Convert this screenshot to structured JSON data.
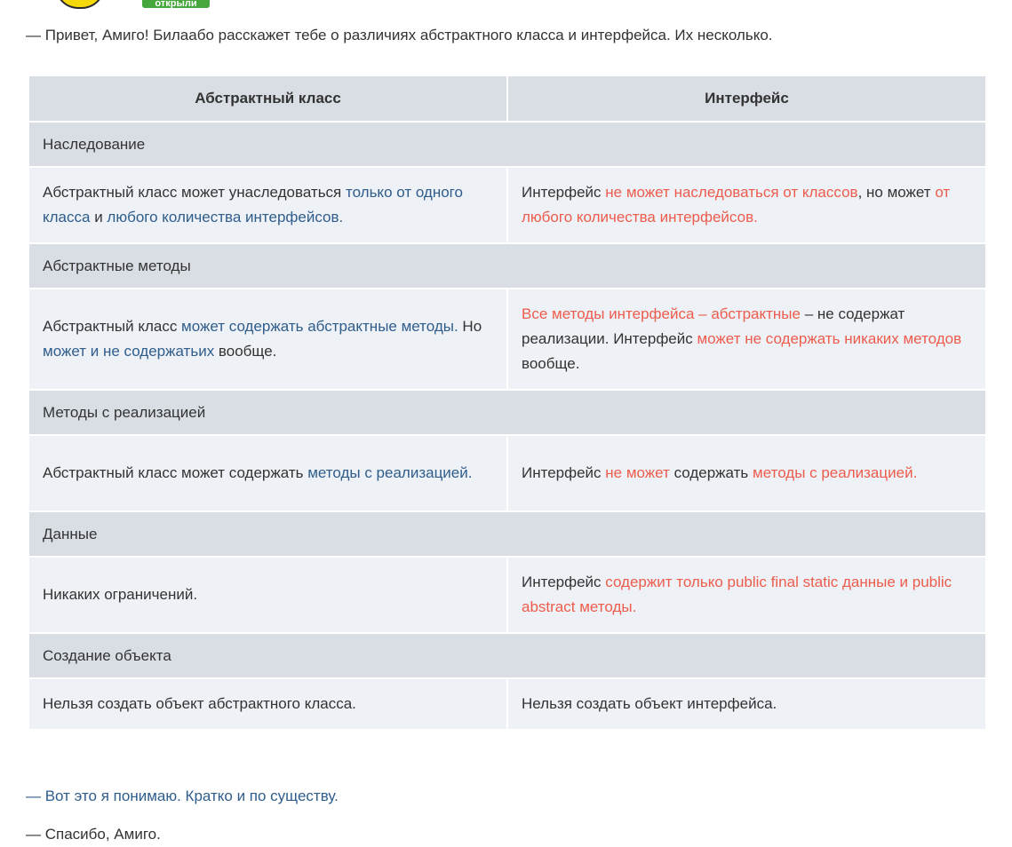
{
  "header": {
    "badge_label": "открыли"
  },
  "intro": "— Привет, Амиго! Билаабо расскажет тебе о различиях абстрактного класса и интерфейса. Их несколько.",
  "table": {
    "headers": [
      "Абстрактный класс",
      "Интерфейс"
    ],
    "sections": [
      {
        "title": "Наследование",
        "left": [
          {
            "t": "Абстрактный класс может унаследоваться ",
            "c": "plain"
          },
          {
            "t": "только от одного класса",
            "c": "blue"
          },
          {
            "t": " и ",
            "c": "plain"
          },
          {
            "t": "любого количества интерфейсов.",
            "c": "blue"
          }
        ],
        "right": [
          {
            "t": "Интерфейс ",
            "c": "plain"
          },
          {
            "t": "не может наследоваться от классов",
            "c": "red"
          },
          {
            "t": ", но может ",
            "c": "plain"
          },
          {
            "t": "от любого количества интерфейсов.",
            "c": "red"
          }
        ]
      },
      {
        "title": "Абстрактные методы",
        "left": [
          {
            "t": "Абстрактный класс ",
            "c": "plain"
          },
          {
            "t": "может содержать абстрактные методы.",
            "c": "blue"
          },
          {
            "t": " Но ",
            "c": "plain"
          },
          {
            "t": "может и не содержатьих",
            "c": "blue"
          },
          {
            "t": " вообще.",
            "c": "plain"
          }
        ],
        "right": [
          {
            "t": "Все методы интерфейса – абстрактные",
            "c": "red"
          },
          {
            "t": " – не содержат реализации. Интерфейс ",
            "c": "plain"
          },
          {
            "t": "может не содержать никаких методов",
            "c": "red"
          },
          {
            "t": " вообще.",
            "c": "plain"
          }
        ]
      },
      {
        "title": "Методы с реализацией",
        "left": [
          {
            "t": "Абстрактный класс может содержать ",
            "c": "plain"
          },
          {
            "t": "методы с реализацией.",
            "c": "blue"
          }
        ],
        "right": [
          {
            "t": "Интерфейс ",
            "c": "plain"
          },
          {
            "t": "не может",
            "c": "red"
          },
          {
            "t": " содержать ",
            "c": "plain"
          },
          {
            "t": "методы с реализацией.",
            "c": "red"
          }
        ]
      },
      {
        "title": "Данные",
        "left": [
          {
            "t": "Никаких ограничений.",
            "c": "plain"
          }
        ],
        "right": [
          {
            "t": "Интерфейс ",
            "c": "plain"
          },
          {
            "t": "содержит только public final static данные и public abstract методы.",
            "c": "red"
          }
        ]
      },
      {
        "title": "Создание объекта",
        "left": [
          {
            "t": "Нельзя создать объект абстрактного класса.",
            "c": "plain"
          }
        ],
        "right": [
          {
            "t": "Нельзя создать объект интерфейса.",
            "c": "plain"
          }
        ]
      }
    ]
  },
  "outro": [
    "— Вот это я понимаю. Кратко и по существу.",
    "— Спасибо, Амиго."
  ],
  "colors": {
    "link_blue": "#2f5d8c",
    "accent_red": "#ee5c4d",
    "header_bg": "#d9dee5",
    "cell_bg": "#eef1f5"
  }
}
